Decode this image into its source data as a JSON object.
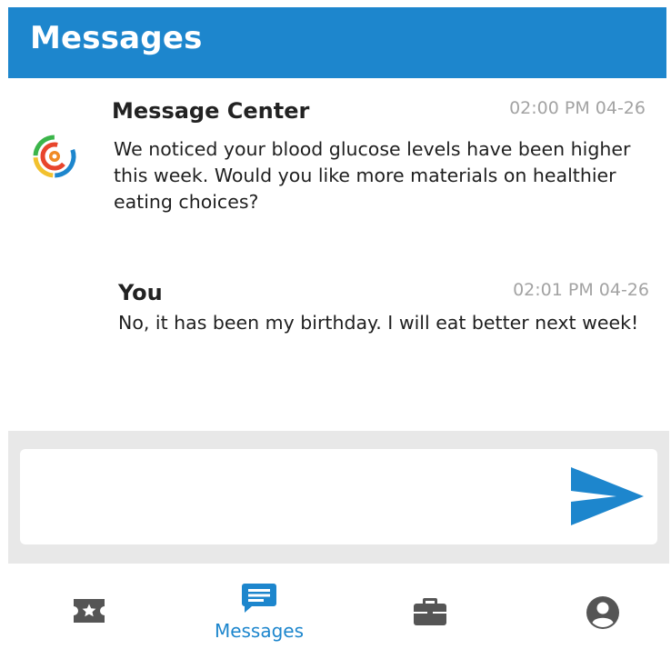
{
  "header": {
    "title": "Messages",
    "color": "#1d86cd"
  },
  "messages": [
    {
      "sender": "Message Center",
      "time": "02:00 PM 04-26",
      "text": "We noticed your blood glucose levels have been higher this week. Would you like more materials on healthier eating choices?",
      "avatar_icon": "message-center-logo-icon"
    },
    {
      "sender": "You",
      "time": "02:01 PM 04-26",
      "text": "No, it has been my birthday. I will eat better next week!"
    }
  ],
  "composer": {
    "value": "",
    "placeholder": "",
    "send_icon": "send-icon",
    "send_color": "#1d86cd"
  },
  "tabs": [
    {
      "icon": "ticket-icon",
      "label": "",
      "active": false
    },
    {
      "icon": "chat-bubble-icon",
      "label": "Messages",
      "active": true
    },
    {
      "icon": "briefcase-icon",
      "label": "",
      "active": false
    },
    {
      "icon": "user-circle-icon",
      "label": "",
      "active": false
    }
  ],
  "colors": {
    "accent": "#1d86cd",
    "inactive_icon": "#555555",
    "timestamp": "#a3a3a3"
  }
}
